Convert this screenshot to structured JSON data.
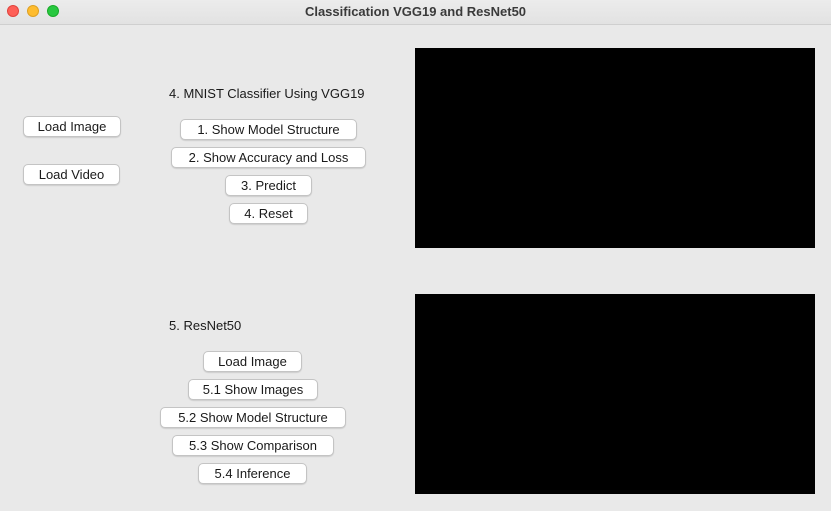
{
  "window": {
    "title": "Classification VGG19 and ResNet50",
    "controls": [
      "close",
      "minimize",
      "maximize"
    ]
  },
  "left_panel": {
    "load_image_label": "Load Image",
    "load_video_label": "Load Video"
  },
  "vgg_section": {
    "heading": "4. MNIST Classifier Using VGG19",
    "buttons": [
      {
        "label": "1. Show Model Structure"
      },
      {
        "label": "2. Show Accuracy and Loss"
      },
      {
        "label": "3. Predict"
      },
      {
        "label": "4. Reset"
      }
    ]
  },
  "resnet_section": {
    "heading": "5. ResNet50",
    "buttons": [
      {
        "label": "Load Image"
      },
      {
        "label": "5.1 Show Images"
      },
      {
        "label": "5.2 Show Model Structure"
      },
      {
        "label": "5.3 Show Comparison"
      },
      {
        "label": "5.4 Inference"
      }
    ]
  },
  "colors": {
    "background": "#e9e9e9",
    "display_panel": "#000000",
    "button": "#ffffff"
  }
}
